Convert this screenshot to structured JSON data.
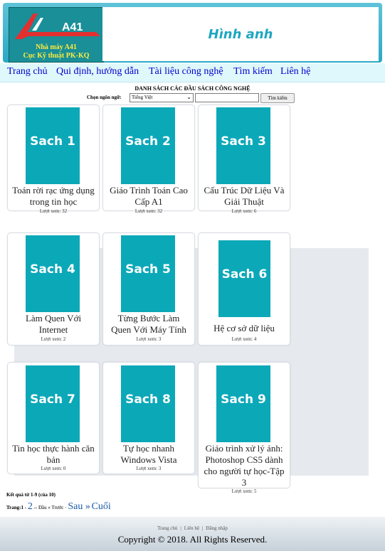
{
  "header": {
    "logo_text": "A41",
    "logo_line1": "Nhà máy A41",
    "logo_line2": "Cục Kỹ thuật PK-KQ",
    "title": "Hình anh"
  },
  "nav": {
    "items": [
      "Trang chủ",
      "Qui định, hướng dẫn",
      "Tài liệu công nghệ",
      "Tìm kiếm",
      "Liên hệ"
    ]
  },
  "list": {
    "title": "DANH SÁCH CÁC ĐẦU SÁCH  CÔNG NGHỆ",
    "lang_label": "Chọn ngôn ngữ:",
    "lang_value": "Tiếng Việt",
    "search_placeholder": "",
    "search_button": "Tìm kiếm"
  },
  "books": [
    {
      "cover": "Sach 1",
      "name": "Toán rời rạc ứng dụng trong tin học",
      "views": "Lượt xem: 32"
    },
    {
      "cover": "Sach 2",
      "name": "Giáo Trình Toán Cao Cấp A1",
      "views": "Lượt xem: 32"
    },
    {
      "cover": "Sach 3",
      "name": "Cấu Trúc Dữ Liệu Và Giải Thuật",
      "views": "Lượt xem: 6"
    },
    {
      "cover": "Sach 4",
      "name": "Làm Quen Với Internet",
      "views": "Lượt xem: 2"
    },
    {
      "cover": "Sach 5",
      "name": "Từng Bước Làm Quen Với Máy Tính",
      "views": "Lượt xem: 3"
    },
    {
      "cover": "Sach 6",
      "name": "Hệ cơ sở dữ liệu",
      "views": "Lượt xem: 4"
    },
    {
      "cover": "Sach 7",
      "name": "Tin học thực hành căn bản",
      "views": "Lượt xem: 0"
    },
    {
      "cover": "Sach 8",
      "name": "Tự học nhanh Windows Vista",
      "views": "Lượt xem: 3"
    },
    {
      "cover": "Sach 9",
      "name": "Giáo trình xử lý ảnh: Photoshop CS5 dành cho người tự học-Tập 3",
      "views": "Lượt xem: 5"
    }
  ],
  "results": "Kết quả từ 1-9 (của 10)",
  "pager": {
    "label": "Trang:",
    "current": "1",
    "sep": " - ",
    "page2": "2",
    "first_prev": "-- Đầu « Trước ·",
    "next": "Sau »",
    "last": "Cuối"
  },
  "footer": {
    "links": [
      "Trang chủ",
      "Liên hệ",
      "Đăng nhập"
    ],
    "copyright": "Copyright © 2018. All Rights Reserved."
  },
  "colors": {
    "header": "#2aa9c4",
    "cover": "#0ba8b8",
    "title": "#1ea7bf",
    "link": "#0000cc"
  }
}
